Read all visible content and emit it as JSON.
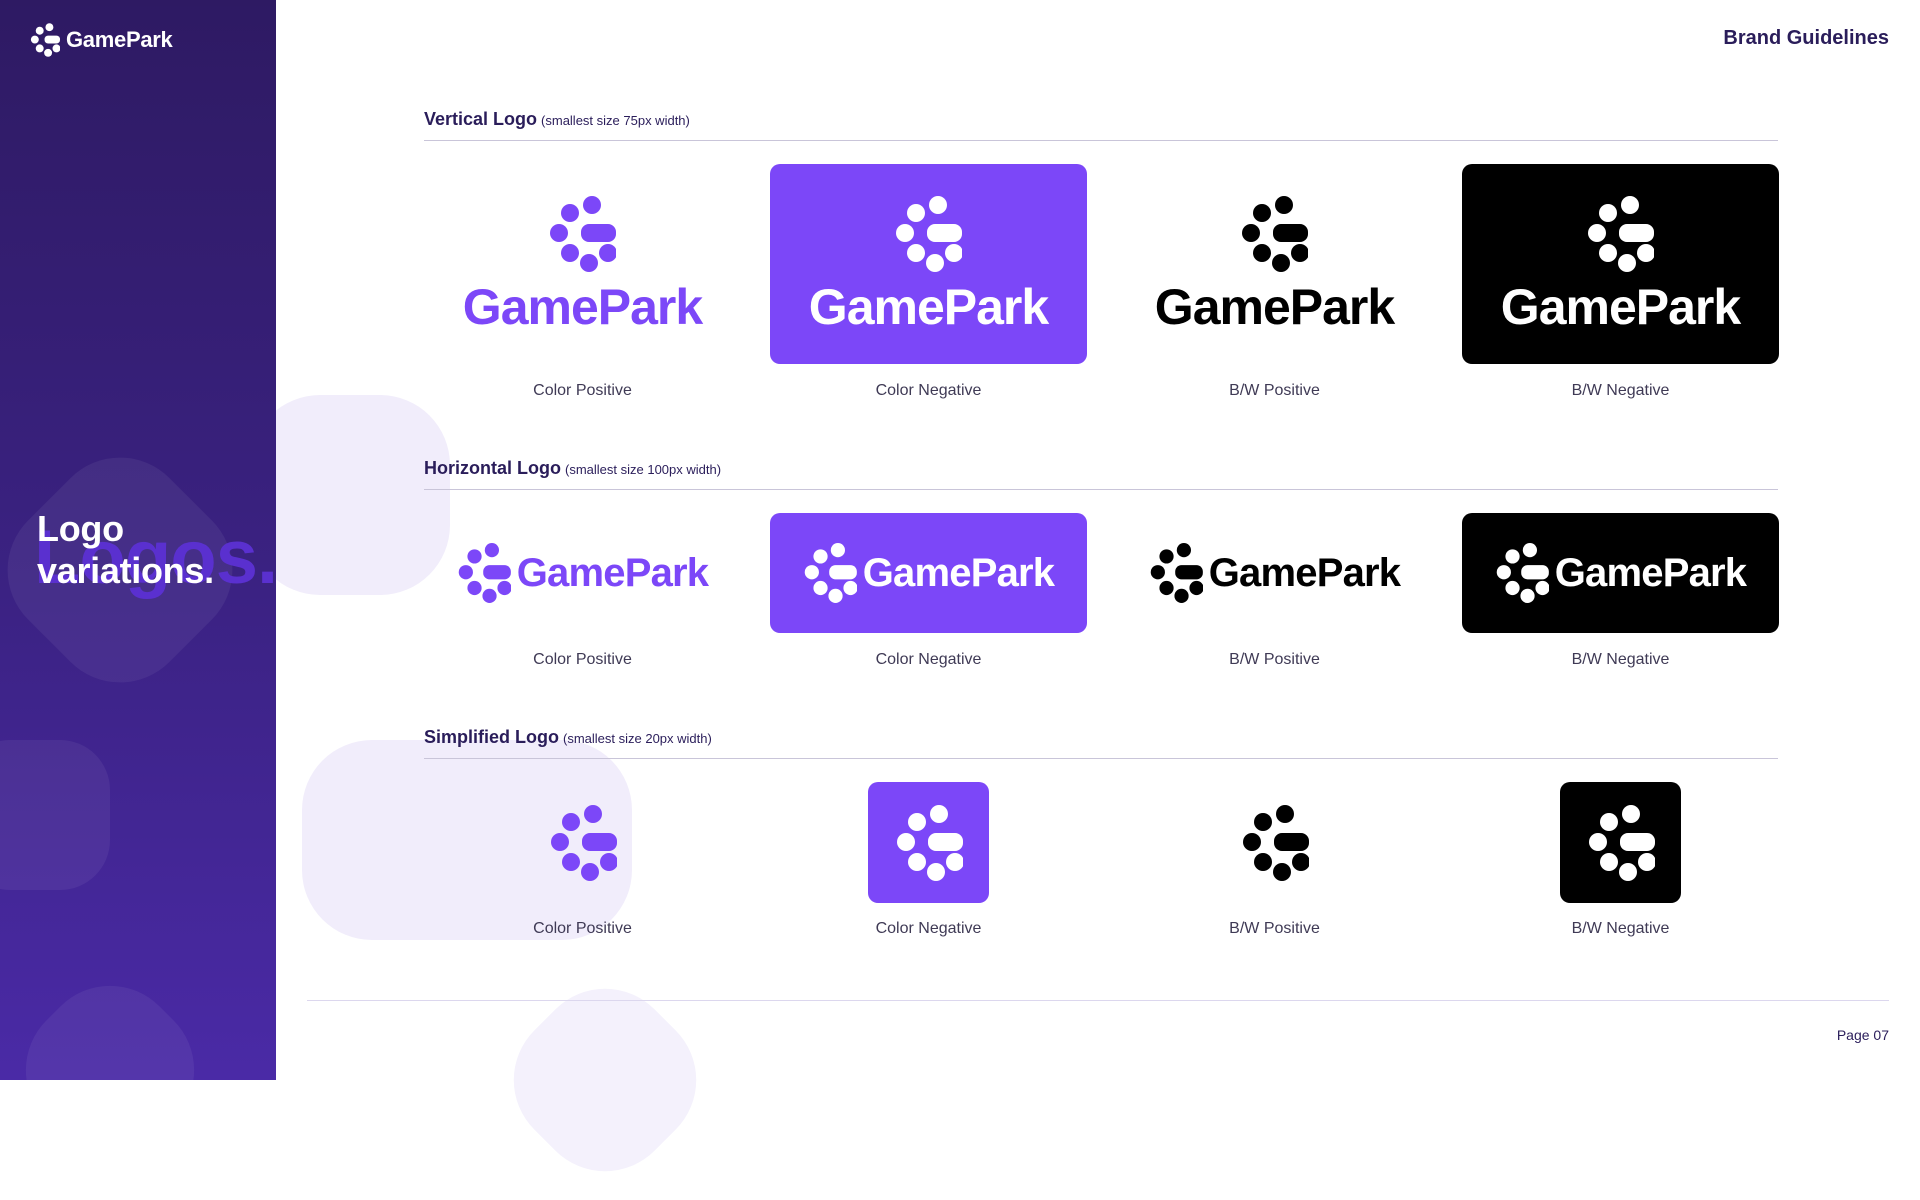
{
  "brand": {
    "name": "GamePark",
    "icon": "gamepark-dots-icon"
  },
  "header": {
    "title": "Brand Guidelines"
  },
  "sidebar": {
    "title": "Logo\nvariations.",
    "watermark": "Logos."
  },
  "colors": {
    "purple": "#7c47f8",
    "sidebar_dark": "#2e1a63",
    "ink": "#2a1d5a",
    "black": "#000000",
    "white": "#ffffff"
  },
  "sections": [
    {
      "title": "Vertical Logo",
      "note": "(smallest size 75px width)",
      "variants": [
        {
          "label": "Color Positive",
          "wordmark": "GamePark"
        },
        {
          "label": "Color Negative",
          "wordmark": "GamePark"
        },
        {
          "label": "B/W Positive",
          "wordmark": "GamePark"
        },
        {
          "label": "B/W Negative",
          "wordmark": "GamePark"
        }
      ]
    },
    {
      "title": "Horizontal Logo",
      "note": "(smallest size 100px width)",
      "variants": [
        {
          "label": "Color Positive",
          "wordmark": "GamePark"
        },
        {
          "label": "Color Negative",
          "wordmark": "GamePark"
        },
        {
          "label": "B/W Positive",
          "wordmark": "GamePark"
        },
        {
          "label": "B/W Negative",
          "wordmark": "GamePark"
        }
      ]
    },
    {
      "title": "Simplified Logo",
      "note": "(smallest size 20px width)",
      "variants": [
        {
          "label": "Color Positive"
        },
        {
          "label": "Color Negative"
        },
        {
          "label": "B/W Positive"
        },
        {
          "label": "B/W Negative"
        }
      ]
    }
  ],
  "footer": {
    "page": "Page 07"
  }
}
